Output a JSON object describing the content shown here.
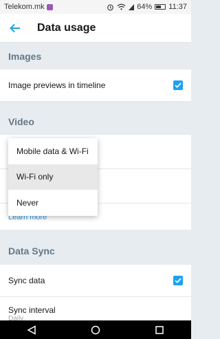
{
  "status_bar": {
    "carrier": "Telekom.mk",
    "battery": "64%",
    "time": "11:37"
  },
  "app_bar": {
    "title": "Data usage"
  },
  "sections": {
    "images": {
      "header": "Images",
      "image_previews_label": "Image previews in timeline",
      "image_previews_checked": true
    },
    "video": {
      "header": "Video",
      "learn_more": "Learn more"
    },
    "data_sync": {
      "header": "Data Sync",
      "sync_data_label": "Sync data",
      "sync_data_checked": true,
      "sync_interval_label": "Sync interval",
      "sync_interval_value": "Daily"
    }
  },
  "menu": {
    "options": [
      "Mobile data & Wi-Fi",
      "Wi-Fi only",
      "Never"
    ],
    "selected": "Wi-Fi only"
  },
  "colors": {
    "accent": "#1da1f2",
    "background": "#e6ecf0"
  },
  "icons": {
    "back": "arrow-left-icon",
    "alarm": "alarm-icon",
    "wifi": "wifi-icon",
    "battery": "battery-icon"
  }
}
